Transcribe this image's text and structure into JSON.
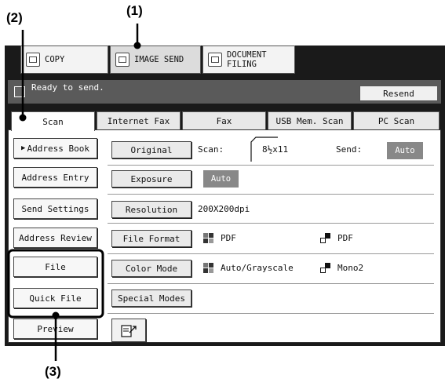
{
  "callouts": {
    "c1": "(1)",
    "c2": "(2)",
    "c3": "(3)"
  },
  "mode_tabs": {
    "copy": "COPY",
    "image_send": "IMAGE SEND",
    "doc_filing_1": "DOCUMENT",
    "doc_filing_2": "FILING"
  },
  "status": {
    "message": "Ready to send.",
    "resend": "Resend"
  },
  "send_tabs": [
    "Scan",
    "Internet Fax",
    "Fax",
    "USB Mem. Scan",
    "PC Scan"
  ],
  "side_buttons": {
    "address_book": "Address Book",
    "address_entry": "Address Entry",
    "send_settings": "Send Settings",
    "address_review": "Address Review",
    "file": "File",
    "quick_file": "Quick File",
    "preview": "Preview"
  },
  "settings": {
    "original": {
      "button": "Original",
      "scan_label": "Scan:",
      "scan_value": "8½x11",
      "send_label": "Send:",
      "send_value": "Auto"
    },
    "exposure": {
      "button": "Exposure",
      "value": "Auto"
    },
    "resolution": {
      "button": "Resolution",
      "value": "200X200dpi"
    },
    "file_format": {
      "button": "File Format",
      "gray_value": "PDF",
      "bw_value": "PDF"
    },
    "color_mode": {
      "button": "Color Mode",
      "gray_value": "Auto/Grayscale",
      "bw_value": "Mono2"
    },
    "special_modes": {
      "button": "Special Modes"
    }
  },
  "colors": {
    "frame": "#1a1a1a",
    "status_bar": "#5a5a5a",
    "auto_badge": "#888888"
  }
}
